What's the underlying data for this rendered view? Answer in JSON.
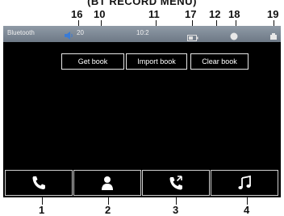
{
  "header": {
    "caption_fragment": "(BT RECORD MENU)"
  },
  "callouts": [
    "16",
    "10",
    "11",
    "17",
    "12",
    "18",
    "19",
    "1",
    "2",
    "3",
    "4"
  ],
  "status_bar": {
    "app_label": "Bluetooth",
    "volume_value": "20",
    "clock": "10:2",
    "icons": {
      "volume": "speaker-icon",
      "battery": "battery-icon",
      "signal": "signal-icon",
      "phone": "phone-device-icon"
    }
  },
  "book_buttons": {
    "get": "Get book",
    "import": "Import book",
    "clear": "Clear book"
  },
  "nav": [
    {
      "name": "call-icon"
    },
    {
      "name": "contacts-icon"
    },
    {
      "name": "call-log-icon"
    },
    {
      "name": "music-icon"
    }
  ],
  "colors": {
    "screen": "#000000",
    "statusbar": "#7d8894",
    "button_border": "#e8e8e8",
    "volume_icon": "#3a7bd5"
  }
}
